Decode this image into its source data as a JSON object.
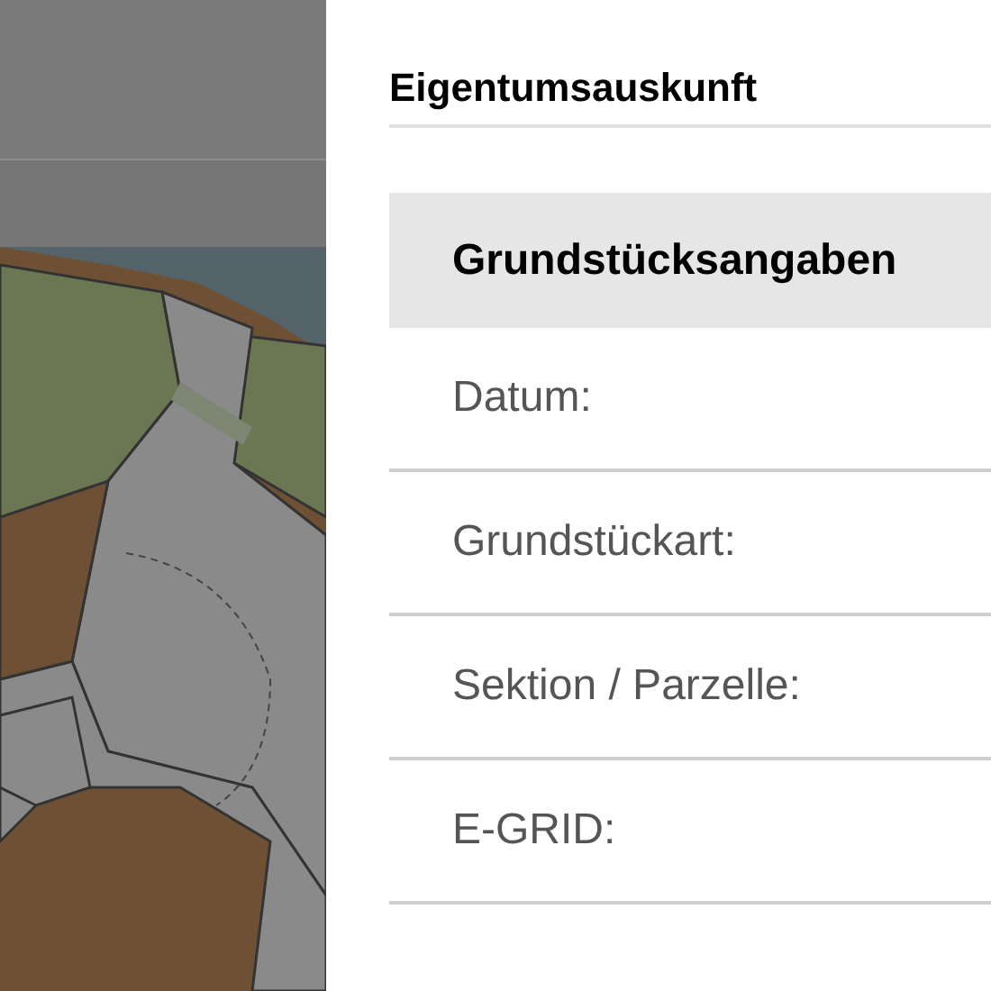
{
  "panel": {
    "title": "Eigentumsauskunft",
    "section": {
      "title": "Grundstücksangaben",
      "rows": [
        {
          "label": "Datum:"
        },
        {
          "label": "Grundstückart:"
        },
        {
          "label": "Sektion / Parzelle:"
        },
        {
          "label": "E-GRID:"
        }
      ]
    }
  }
}
